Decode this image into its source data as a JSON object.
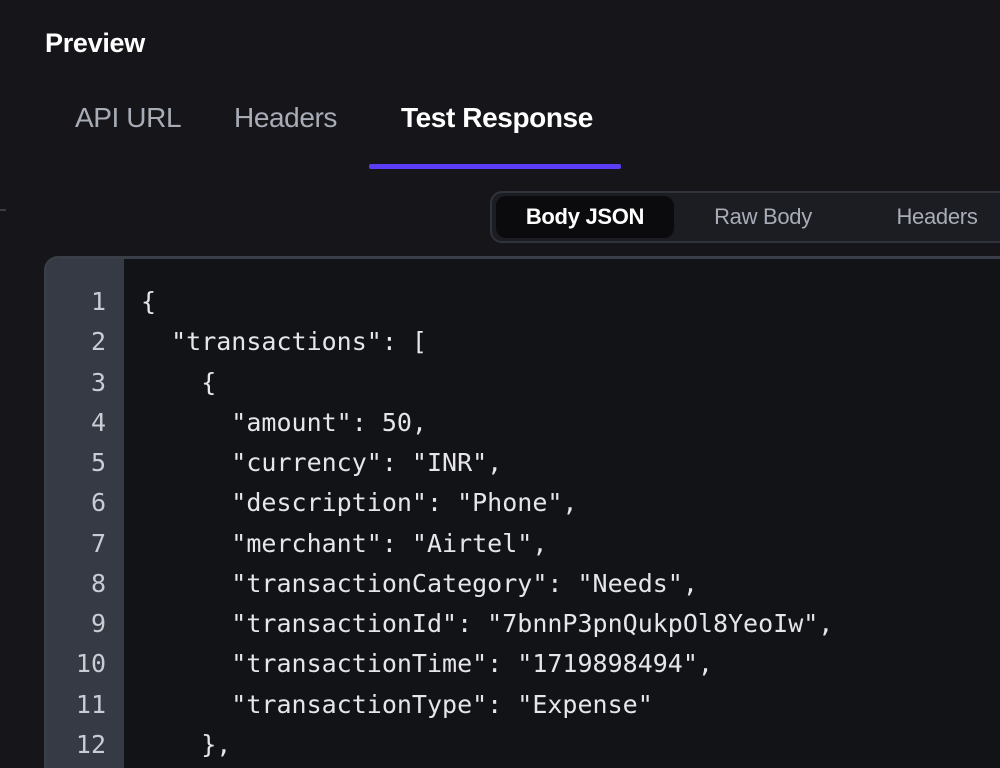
{
  "preview": {
    "title": "Preview"
  },
  "tabs": [
    {
      "label": "API URL",
      "active": false
    },
    {
      "label": "Headers",
      "active": false
    },
    {
      "label": "Test Response",
      "active": true
    }
  ],
  "response_view": {
    "options": [
      {
        "label": "Body JSON",
        "active": true
      },
      {
        "label": "Raw Body",
        "active": false
      },
      {
        "label": "Headers",
        "active": false
      }
    ]
  },
  "colors": {
    "background": "#16161a",
    "accent_underline": "#5b3df5",
    "gutter": "#353a44",
    "editor_background": "#121316"
  },
  "code_editor": {
    "line_numbers": [
      "1",
      "2",
      "3",
      "4",
      "5",
      "6",
      "7",
      "8",
      "9",
      "10",
      "11",
      "12"
    ],
    "lines": [
      "{",
      "  \"transactions\": [",
      "    {",
      "      \"amount\": 50,",
      "      \"currency\": \"INR\",",
      "      \"description\": \"Phone\",",
      "      \"merchant\": \"Airtel\",",
      "      \"transactionCategory\": \"Needs\",",
      "      \"transactionId\": \"7bnnP3pnQukpOl8YeoIw\",",
      "      \"transactionTime\": \"1719898494\",",
      "      \"transactionType\": \"Expense\"",
      "    },"
    ]
  }
}
